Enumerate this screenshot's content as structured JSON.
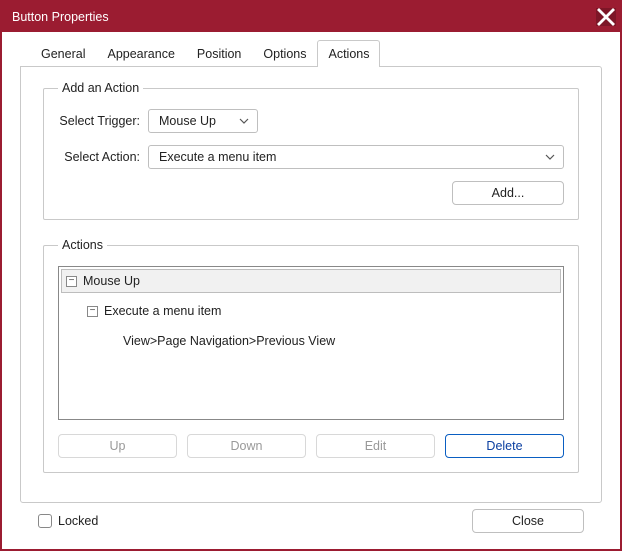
{
  "window": {
    "title": "Button Properties"
  },
  "tabs": {
    "general": "General",
    "appearance": "Appearance",
    "position": "Position",
    "options": "Options",
    "actions": "Actions",
    "active": "actions"
  },
  "addAction": {
    "legend": "Add an Action",
    "triggerLabel": "Select Trigger:",
    "triggerValue": "Mouse Up",
    "actionLabel": "Select Action:",
    "actionValue": "Execute a menu item",
    "addBtn": "Add..."
  },
  "actionsGroup": {
    "legend": "Actions",
    "tree": {
      "root": "Mouse Up",
      "child": "Execute a menu item",
      "leaf": "View>Page Navigation>Previous View"
    },
    "buttons": {
      "up": "Up",
      "down": "Down",
      "edit": "Edit",
      "delete": "Delete"
    }
  },
  "footer": {
    "locked": "Locked",
    "close": "Close"
  }
}
